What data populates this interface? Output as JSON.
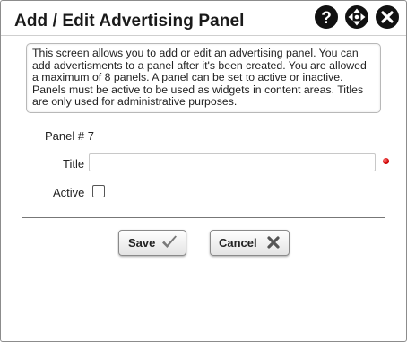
{
  "dialog": {
    "title": "Add / Edit Advertising Panel",
    "icons": [
      "help-icon",
      "move-icon",
      "close-icon"
    ]
  },
  "info_text": "This screen allows you to add or edit an advertising panel. You can add advertisments to a panel after it's been created. You are allowed a maximum of 8 panels. A panel can be set to active or inactive. Panels must be active to be used as widgets in content areas. Titles are only used for administrative purposes.",
  "form": {
    "panel_number": "Panel # 7",
    "title_label": "Title",
    "title_value": "",
    "title_required": true,
    "active_label": "Active",
    "active_checked": false
  },
  "buttons": {
    "save": "Save",
    "cancel": "Cancel"
  },
  "colors": {
    "icon_bg": "#111111",
    "required_dot": "#d00000",
    "save_check": "#7a7a7a",
    "cancel_x": "#555555"
  }
}
